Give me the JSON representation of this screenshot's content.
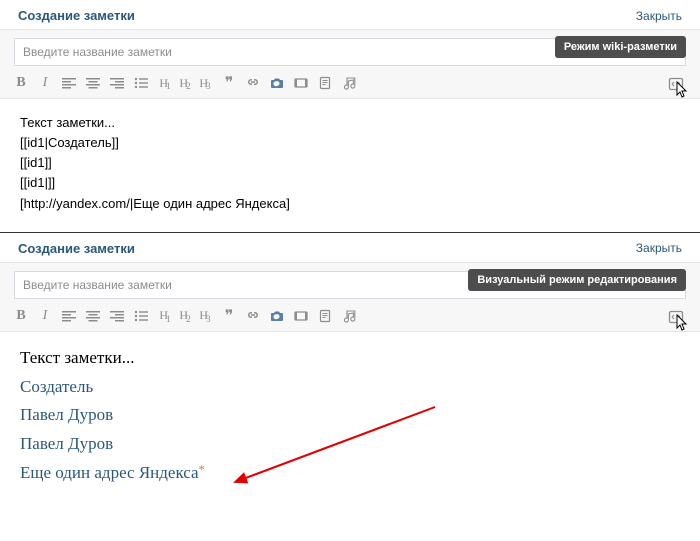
{
  "panel1": {
    "title": "Создание заметки",
    "close": "Закрыть",
    "title_placeholder": "Введите название заметки",
    "mode_badge": "Режим wiki-разметки",
    "content_lines": [
      "Текст заметки...",
      "[[id1|Создатель]]",
      "[[id1]]",
      "[[id1|]]",
      "[http://yandex.com/|Еще один адрес Яндекса]"
    ]
  },
  "panel2": {
    "title": "Создание заметки",
    "close": "Закрыть",
    "title_placeholder": "Введите название заметки",
    "mode_badge": "Визуальный режим редактирования",
    "plain_text": "Текст заметки...",
    "links": [
      "Создатель",
      "Павел Дуров",
      "Павел Дуров"
    ],
    "ext_link": "Еще один адрес Яндекса",
    "ext_mark": "*"
  },
  "toolbar": {
    "bold": "B",
    "italic": "I",
    "h1a": "H",
    "h1b": "1",
    "h2a": "H",
    "h2b": "2",
    "h3a": "H",
    "h3b": "3",
    "quote": "❞"
  }
}
